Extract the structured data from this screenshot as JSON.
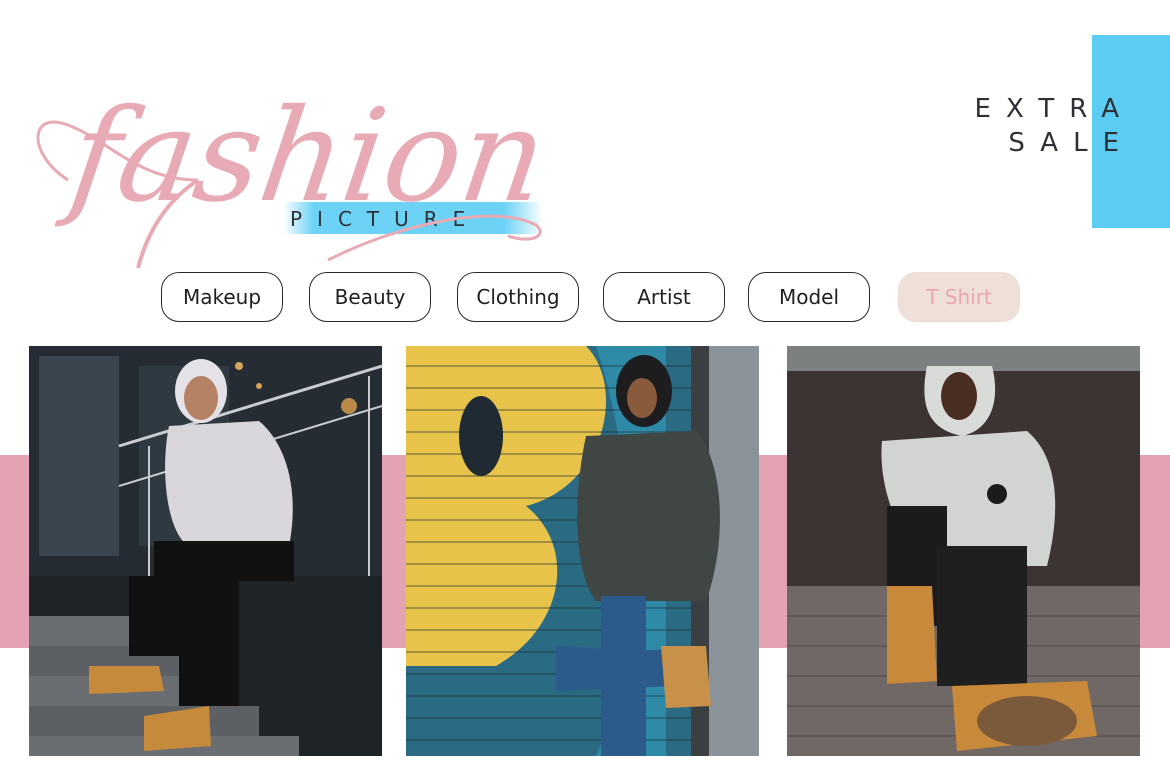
{
  "brand": {
    "script_text": "fashion",
    "subtitle": "PICTURE"
  },
  "sale": {
    "line1": "EXTRA",
    "line2": "SALE"
  },
  "categories": [
    {
      "label": "Makeup",
      "active": false
    },
    {
      "label": "Beauty",
      "active": false
    },
    {
      "label": "Clothing",
      "active": false
    },
    {
      "label": "Artist",
      "active": false
    },
    {
      "label": "Model",
      "active": false
    },
    {
      "label": "T Shirt",
      "active": true
    }
  ],
  "colors": {
    "brand_pink": "#e8aab5",
    "accent_blue": "#5bcdf5",
    "band_pink": "#e3a3b3",
    "text_dark": "#2d3136",
    "active_pill_bg": "#efdfd9",
    "active_pill_text": "#e9a6ad"
  },
  "photos": [
    {
      "name": "model-on-stairs"
    },
    {
      "name": "model-at-graffiti-wall"
    },
    {
      "name": "model-sitting-on-pavement"
    }
  ]
}
